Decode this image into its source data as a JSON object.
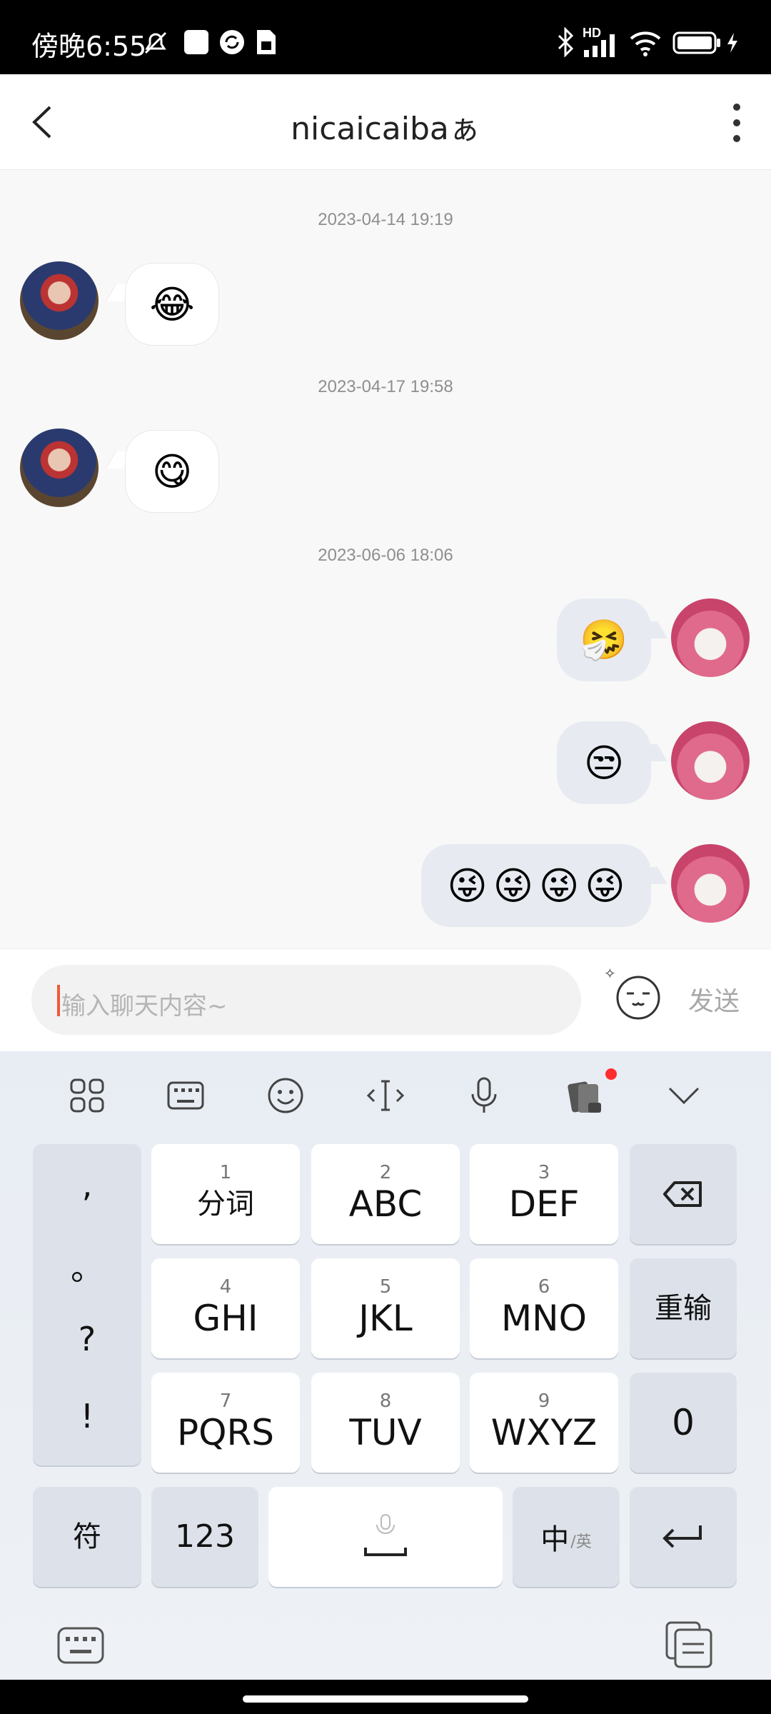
{
  "status_bar": {
    "time": "傍晚6:55",
    "network_label": "HD"
  },
  "header": {
    "title": "nicaicaibaぁ"
  },
  "messages": [
    {
      "timestamp": "2023-04-14 19:19",
      "side": "left",
      "emojis": [
        "😂"
      ]
    },
    {
      "timestamp": "2023-04-17 19:58",
      "side": "left",
      "emojis": [
        "😋"
      ]
    },
    {
      "timestamp": "2023-06-06 18:06",
      "side": "right",
      "emojis": [
        "🤧"
      ]
    },
    {
      "timestamp": "",
      "side": "right",
      "emojis": [
        "😒"
      ]
    },
    {
      "timestamp": "",
      "side": "right",
      "emojis": [
        "😜",
        "😜",
        "😜",
        "😜"
      ]
    }
  ],
  "input": {
    "placeholder": "输入聊天内容~",
    "send_label": "发送"
  },
  "keyboard": {
    "punctuation": [
      ",",
      "。",
      "?",
      "!"
    ],
    "keys": [
      {
        "num": "1",
        "label": "分词"
      },
      {
        "num": "2",
        "label": "ABC"
      },
      {
        "num": "3",
        "label": "DEF"
      },
      {
        "num": "4",
        "label": "GHI"
      },
      {
        "num": "5",
        "label": "JKL"
      },
      {
        "num": "6",
        "label": "MNO"
      },
      {
        "num": "7",
        "label": "PQRS"
      },
      {
        "num": "8",
        "label": "TUV"
      },
      {
        "num": "9",
        "label": "WXYZ"
      }
    ],
    "reinput_label": "重输",
    "zero_label": "0",
    "symbol_label": "符",
    "numeric_label": "123",
    "lang_main": "中",
    "lang_alt": "/英"
  },
  "colors": {
    "accent_caret": "#f0593a",
    "notification_dot": "#ff2d2d"
  }
}
